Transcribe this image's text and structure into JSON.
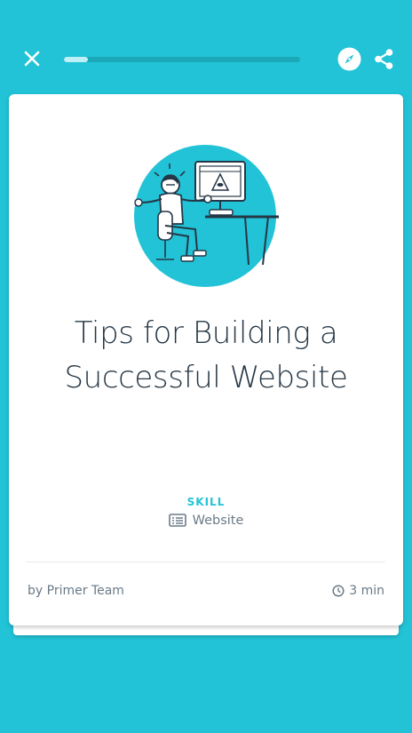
{
  "header": {
    "progress_percent": 10
  },
  "card": {
    "title_line1": "Tips for Building a",
    "title_line2": "Successful Website",
    "category_label": "SKILL",
    "category_value": "Website",
    "author": "by Primer Team",
    "duration": "3 min"
  },
  "icons": {
    "close": "close-icon",
    "compass": "compass-icon",
    "share": "share-icon",
    "list": "list-icon",
    "clock": "clock-icon"
  },
  "colors": {
    "background": "#22c3d7",
    "card": "#ffffff",
    "title_text": "#253746",
    "accent": "#22c3d7",
    "muted_text": "#6a7a88",
    "illustration_circle": "#22c3d7"
  }
}
